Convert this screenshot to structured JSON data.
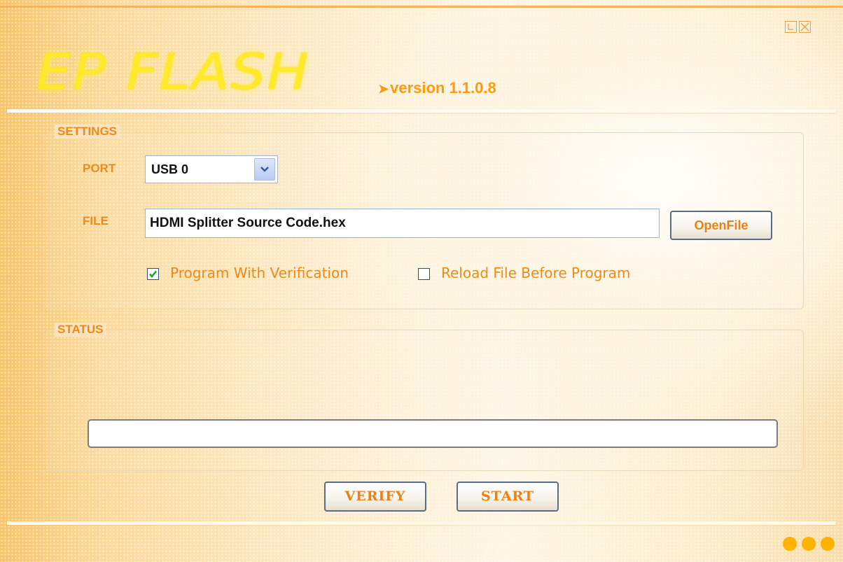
{
  "app": {
    "logo_text": "EP FLASH",
    "version_arrow": "➤",
    "version_text": "version 1.1.0.8"
  },
  "window_controls": {
    "minimize_icon": "minimize-icon",
    "close_icon": "close-icon"
  },
  "settings": {
    "legend": "SETTINGS",
    "port_label": "PORT",
    "port_value": "USB 0",
    "file_label": "FILE",
    "file_value": "HDMI Splitter Source Code.hex",
    "openfile_label": "OpenFile",
    "verify_checkbox": {
      "label": "Program With Verification",
      "checked": true
    },
    "reload_checkbox": {
      "label": "Reload File Before Program",
      "checked": false
    }
  },
  "status": {
    "legend": "STATUS",
    "progress": 0
  },
  "actions": {
    "verify_label": "VERIFY",
    "start_label": "START"
  },
  "colors": {
    "accent": "#ef8a1a",
    "logo": "#ffea2a",
    "dots": "#ffb300"
  }
}
